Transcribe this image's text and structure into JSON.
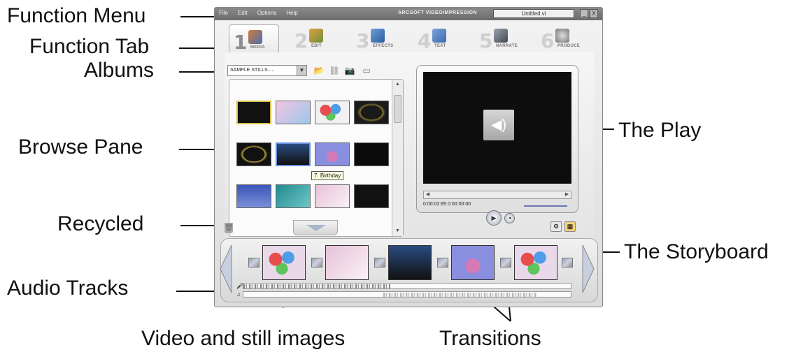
{
  "callouts": {
    "function_menu": "Function Menu",
    "function_tab": "Function Tab",
    "albums": "Albums",
    "browse_pane": "Browse Pane",
    "recycled": "Recycled",
    "audio_tracks": "Audio Tracks",
    "the_play": "The Play",
    "the_storyboard": "The Storyboard",
    "video_and_still_images": "Video and still images",
    "transitions": "Transitions"
  },
  "app": {
    "menu": [
      "File",
      "Edit",
      "Options",
      "Help"
    ],
    "brand": "ARCSOFT VIDEOIMPRESSION",
    "document_name": "Untitled.vi",
    "window_buttons": [
      "_",
      "X"
    ]
  },
  "tabs": [
    {
      "number": "1",
      "label": "MEDIA",
      "icon": "media-icon",
      "active": true
    },
    {
      "number": "2",
      "label": "EDIT",
      "icon": "scissors-icon",
      "active": false
    },
    {
      "number": "3",
      "label": "EFFECTS",
      "icon": "effects-icon",
      "active": false
    },
    {
      "number": "4",
      "label": "TEXT",
      "icon": "text-icon",
      "active": false
    },
    {
      "number": "5",
      "label": "NARRATE",
      "icon": "microphone-icon",
      "active": false
    },
    {
      "number": "6",
      "label": "PRODUCE",
      "icon": "film-reel-icon",
      "active": false
    }
  ],
  "albums": {
    "selected": "SAMPLE STILLS.....",
    "tools": [
      "open-folder-icon",
      "link-icon",
      "camera-icon",
      "scanner-icon"
    ]
  },
  "browse": {
    "tooltip": "7. Birthday",
    "thumbnail_count": 12
  },
  "player": {
    "timecode": "0:00:02:95  0:00:00:00"
  },
  "storyboard": {
    "clips": [
      "balloons",
      "flowers",
      "big-show",
      "birthday",
      "balloons"
    ],
    "transition_count": 6
  },
  "colors": {
    "accent": "#6a78b5",
    "screen": "#0d0d0d",
    "titlebar": "#6b6b6b"
  }
}
